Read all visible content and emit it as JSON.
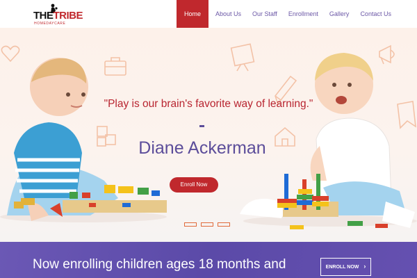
{
  "logo": {
    "main_a": "THE",
    "main_b": "TRIBE",
    "sub": "HOMEDAYCARE"
  },
  "nav": {
    "items": [
      {
        "label": "Home",
        "active": true
      },
      {
        "label": "About Us"
      },
      {
        "label": "Our Staff"
      },
      {
        "label": "Enrollment"
      },
      {
        "label": "Gallery"
      },
      {
        "label": "Contact Us"
      }
    ]
  },
  "hero": {
    "quote": "\"Play is our brain's favorite way of learning.\"",
    "author": "Diane Ackerman",
    "button_label": "Enroll Now",
    "slide_count": 3,
    "active_slide": 1
  },
  "banner": {
    "text": "Now enrolling children ages 18 months and",
    "button_label": "ENROLL NOW",
    "button_icon": "chevron-right-icon"
  },
  "colors": {
    "brand_red": "#c0282d",
    "accent_purple": "#5c4d9a",
    "banner_purple": "#5b4aa8"
  }
}
